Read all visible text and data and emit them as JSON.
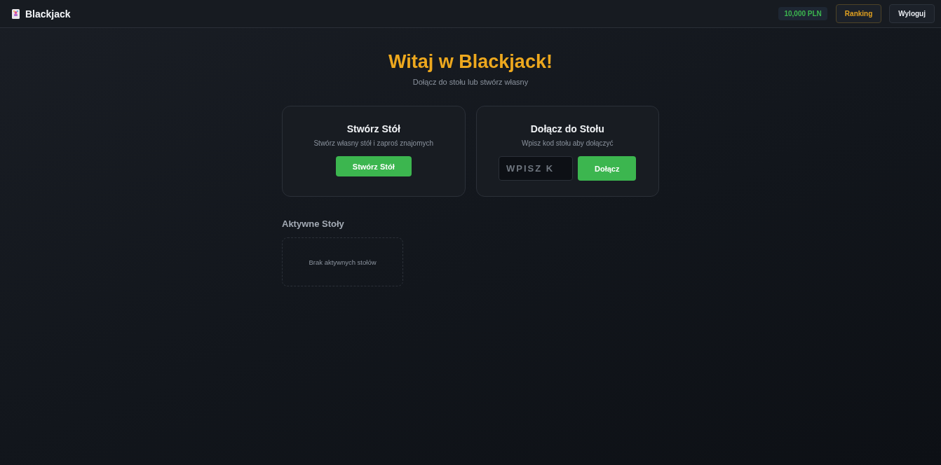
{
  "header": {
    "logo": "Blackjack",
    "balance": "10,000 PLN",
    "buttons": [
      {
        "label": "Ranking",
        "kind": "accent"
      },
      {
        "label": "Wyloguj",
        "kind": "plain"
      }
    ]
  },
  "hero": {
    "title": "Witaj w Blackjack!",
    "subtitle": "Dołącz do stołu lub stwórz własny"
  },
  "cards": [
    {
      "kind": "create",
      "title": "Stwórz Stół",
      "description": "Stwórz własny stół i zaproś znajomych",
      "button": "Stwórz Stół"
    },
    {
      "kind": "join",
      "title": "Dołącz do Stołu",
      "description": "Wpisz kod stołu aby dołączyć",
      "field": {
        "placeholder": "WPISZ K"
      },
      "button": "Dołącz"
    }
  ],
  "active_tables": {
    "title": "Aktywne Stoły",
    "empty_message": "Brak aktywnych stołów"
  }
}
